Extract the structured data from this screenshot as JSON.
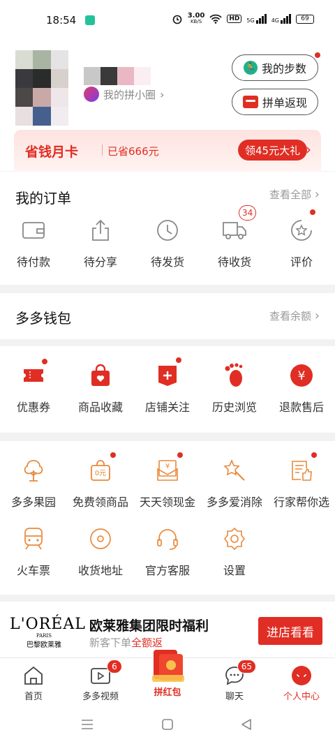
{
  "status_bar": {
    "time": "18:54",
    "net_speed_value": "3.00",
    "net_speed_unit": "KB/S",
    "hd": "HD",
    "sim1": "5G",
    "sim2": "4G",
    "battery": "69"
  },
  "profile": {
    "circle_link": "我的拼小圈",
    "steps_button": "我的步数",
    "refund_button": "拼单返现"
  },
  "month_card": {
    "title": "省钱月卡",
    "saved": "已省666元",
    "gift_button": "领45元大礼"
  },
  "orders": {
    "title": "我的订单",
    "view_all": "查看全部",
    "items": [
      {
        "label": "待付款",
        "icon": "wallet-icon"
      },
      {
        "label": "待分享",
        "icon": "share-icon"
      },
      {
        "label": "待发货",
        "icon": "clock-icon"
      },
      {
        "label": "待收货",
        "icon": "truck-icon",
        "badge": "34"
      },
      {
        "label": "评价",
        "icon": "review-icon"
      }
    ]
  },
  "wallet": {
    "title": "多多钱包",
    "view_balance": "查看余额"
  },
  "shortcuts": [
    {
      "label": "优惠券",
      "icon": "coupon-icon"
    },
    {
      "label": "商品收藏",
      "icon": "favorite-bag-icon"
    },
    {
      "label": "店铺关注",
      "icon": "store-follow-icon"
    },
    {
      "label": "历史浏览",
      "icon": "footprint-icon"
    },
    {
      "label": "退款售后",
      "icon": "refund-yen-icon"
    }
  ],
  "services": [
    {
      "label": "多多果园",
      "icon": "tree-icon"
    },
    {
      "label": "免费领商品",
      "icon": "free-bag-icon",
      "icon_text": "0元"
    },
    {
      "label": "天天领现金",
      "icon": "cash-envelope-icon"
    },
    {
      "label": "多多爱消除",
      "icon": "star-wand-icon"
    },
    {
      "label": "行家帮你选",
      "icon": "thumbs-up-doc-icon"
    },
    {
      "label": "火车票",
      "icon": "train-icon"
    },
    {
      "label": "收货地址",
      "icon": "location-icon"
    },
    {
      "label": "官方客服",
      "icon": "headset-icon"
    },
    {
      "label": "设置",
      "icon": "settings-gear-icon"
    }
  ],
  "ad": {
    "brand_logo": "L'ORÉAL",
    "brand_sub": "PARIS",
    "brand_cn": "巴黎欧莱雅",
    "title": "欧莱雅集团限时福利",
    "subtitle_prefix": "新客下单",
    "subtitle_highlight": "全额返",
    "button": "进店看看"
  },
  "tabbar": [
    {
      "label": "首页",
      "icon": "home-icon"
    },
    {
      "label": "多多视频",
      "icon": "video-icon",
      "badge": "6"
    },
    {
      "label": "拼红包",
      "icon": "red-packet-icon"
    },
    {
      "label": "聊天",
      "icon": "chat-icon",
      "badge": "65"
    },
    {
      "label": "个人中心",
      "icon": "profile-center-icon"
    }
  ],
  "colors": {
    "brand_red": "#e02e24",
    "orange_icon": "#e8893a",
    "page_bg": "#f2f2f2"
  }
}
